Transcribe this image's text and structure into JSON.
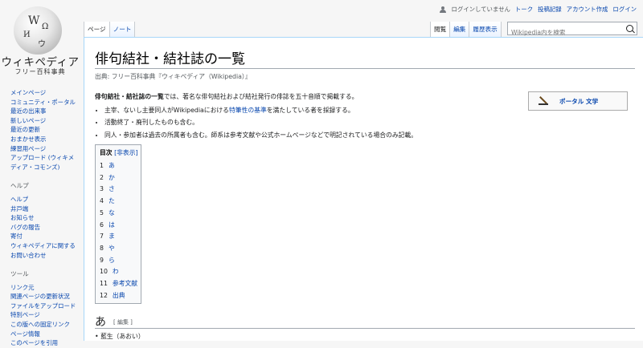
{
  "logo": {
    "title": "ウィキペディア",
    "subtitle": "フリー百科事典",
    "glyphs": [
      "W",
      "Ω",
      "И",
      "ウ"
    ]
  },
  "personal": {
    "not_logged_in": "ログインしていません",
    "talk": "トーク",
    "contributions": "投稿記録",
    "create_account": "アカウント作成",
    "login": "ログイン"
  },
  "tabs_left": [
    "ページ",
    "ノート"
  ],
  "tabs_right": [
    "閲覧",
    "編集",
    "履歴表示"
  ],
  "search": {
    "placeholder": "Wikipedia内を検索"
  },
  "sidebar": {
    "nav": [
      "メインページ",
      "コミュニティ・ポータル",
      "最近の出来事",
      "新しいページ",
      "最近の更新",
      "おまかせ表示",
      "練習用ページ",
      "アップロード (ウィキメディア・コモンズ)"
    ],
    "help_heading": "ヘルプ",
    "help": [
      "ヘルプ",
      "井戸端",
      "お知らせ",
      "バグの報告",
      "寄付",
      "ウィキペディアに関するお問い合わせ"
    ],
    "tools_heading": "ツール",
    "tools": [
      "リンク元",
      "関連ページの更新状況",
      "ファイルをアップロード",
      "特別ページ",
      "この版への固定リンク",
      "ページ情報",
      "このページを引用"
    ]
  },
  "article": {
    "title": "俳句結社・結社誌の一覧",
    "from": "出典: フリー百科事典『ウィキペディア（Wikipedia）』",
    "intro_bold": "俳句結社・結社誌の一覧",
    "intro_rest": "では、著名な俳句結社および結社発行の俳誌を五十音順で掲載する。",
    "bullet1_pre": "主宰、ないし主要同人がWikipediaにおける",
    "bullet1_link": "特筆性の基準",
    "bullet1_post": "を満たしている者を採録する。",
    "bullet2": "活動終了・廃刊したものも含む。",
    "bullet3": "同人・参加者は過去の所属者も含む。師系は参考文献や公式ホームページなどで明記されている場合のみ記載。"
  },
  "portal": {
    "label": "ポータル 文学"
  },
  "toc": {
    "title": "目次",
    "toggle": "[非表示]",
    "items": [
      {
        "num": "1",
        "label": "あ"
      },
      {
        "num": "2",
        "label": "か"
      },
      {
        "num": "3",
        "label": "さ"
      },
      {
        "num": "4",
        "label": "た"
      },
      {
        "num": "5",
        "label": "な"
      },
      {
        "num": "6",
        "label": "は"
      },
      {
        "num": "7",
        "label": "ま"
      },
      {
        "num": "8",
        "label": "や"
      },
      {
        "num": "9",
        "label": "ら"
      },
      {
        "num": "10",
        "label": "わ"
      },
      {
        "num": "11",
        "label": "参考文献"
      },
      {
        "num": "12",
        "label": "出典"
      }
    ]
  },
  "section": {
    "title": "あ",
    "edit": "[ 編集 ]",
    "first_item": "藍生（あおい）"
  }
}
